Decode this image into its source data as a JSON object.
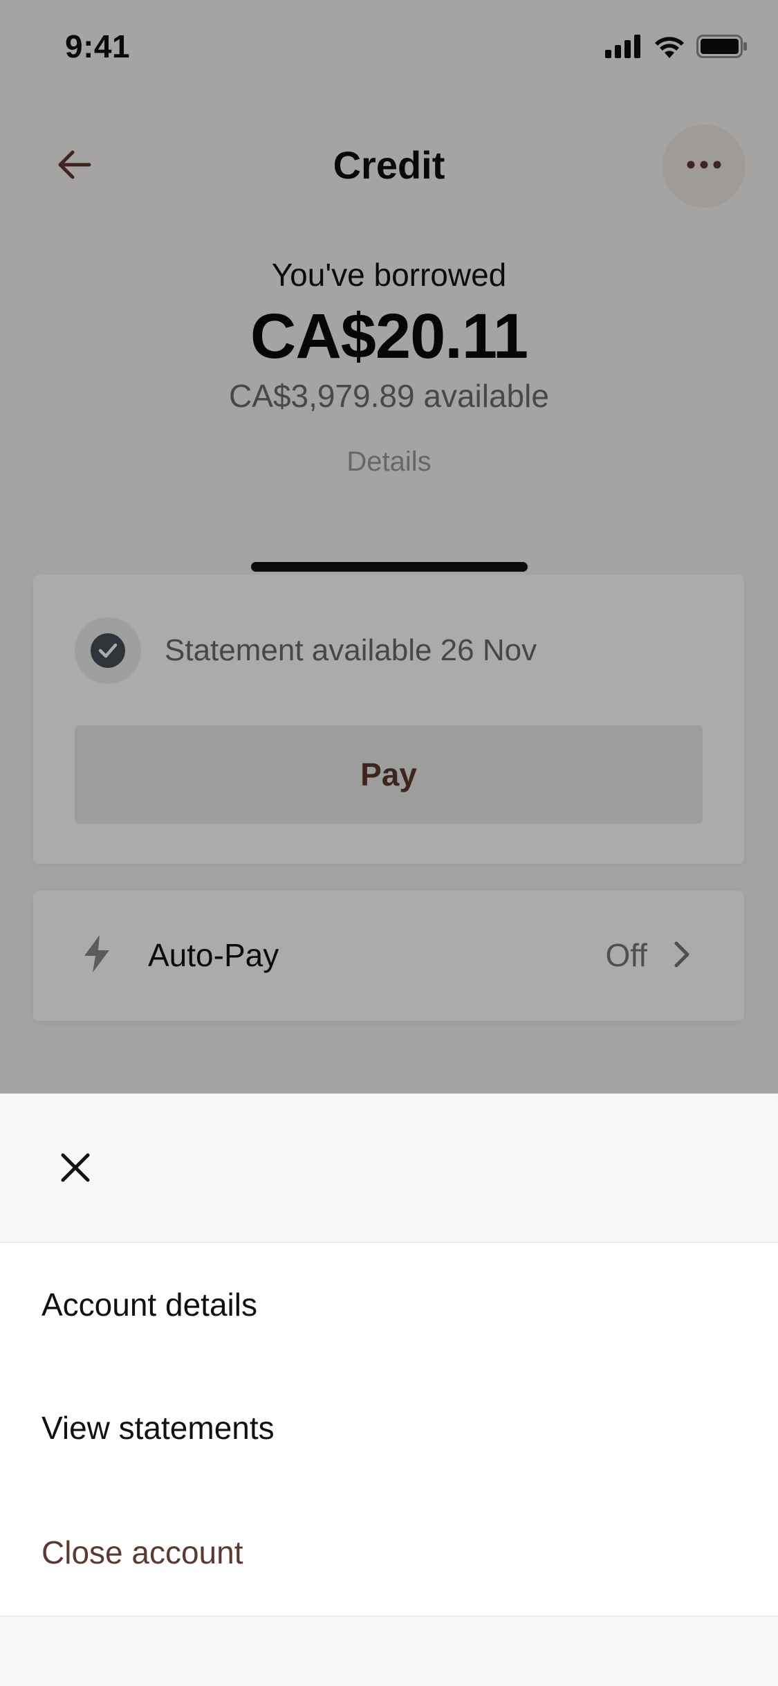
{
  "status_bar": {
    "time": "9:41"
  },
  "header": {
    "title": "Credit",
    "back_icon": "arrow-left-icon",
    "more_icon": "more-horizontal-icon"
  },
  "balance": {
    "label": "You've borrowed",
    "amount": "CA$20.11",
    "available": "CA$3,979.89 available",
    "details_link": "Details"
  },
  "statement_card": {
    "status_text": "Statement available 26 Nov",
    "status_icon": "check-circle-icon",
    "pay_label": "Pay"
  },
  "autopay": {
    "label": "Auto-Pay",
    "value": "Off",
    "icon": "lightning-icon"
  },
  "sheet": {
    "close_icon": "close-icon",
    "items": [
      {
        "label": "Account details"
      },
      {
        "label": "View statements"
      },
      {
        "label": "Close account"
      }
    ]
  },
  "colors": {
    "accent_brown": "#5a3a34",
    "overlay": "rgba(0,0,0,0.33)"
  }
}
